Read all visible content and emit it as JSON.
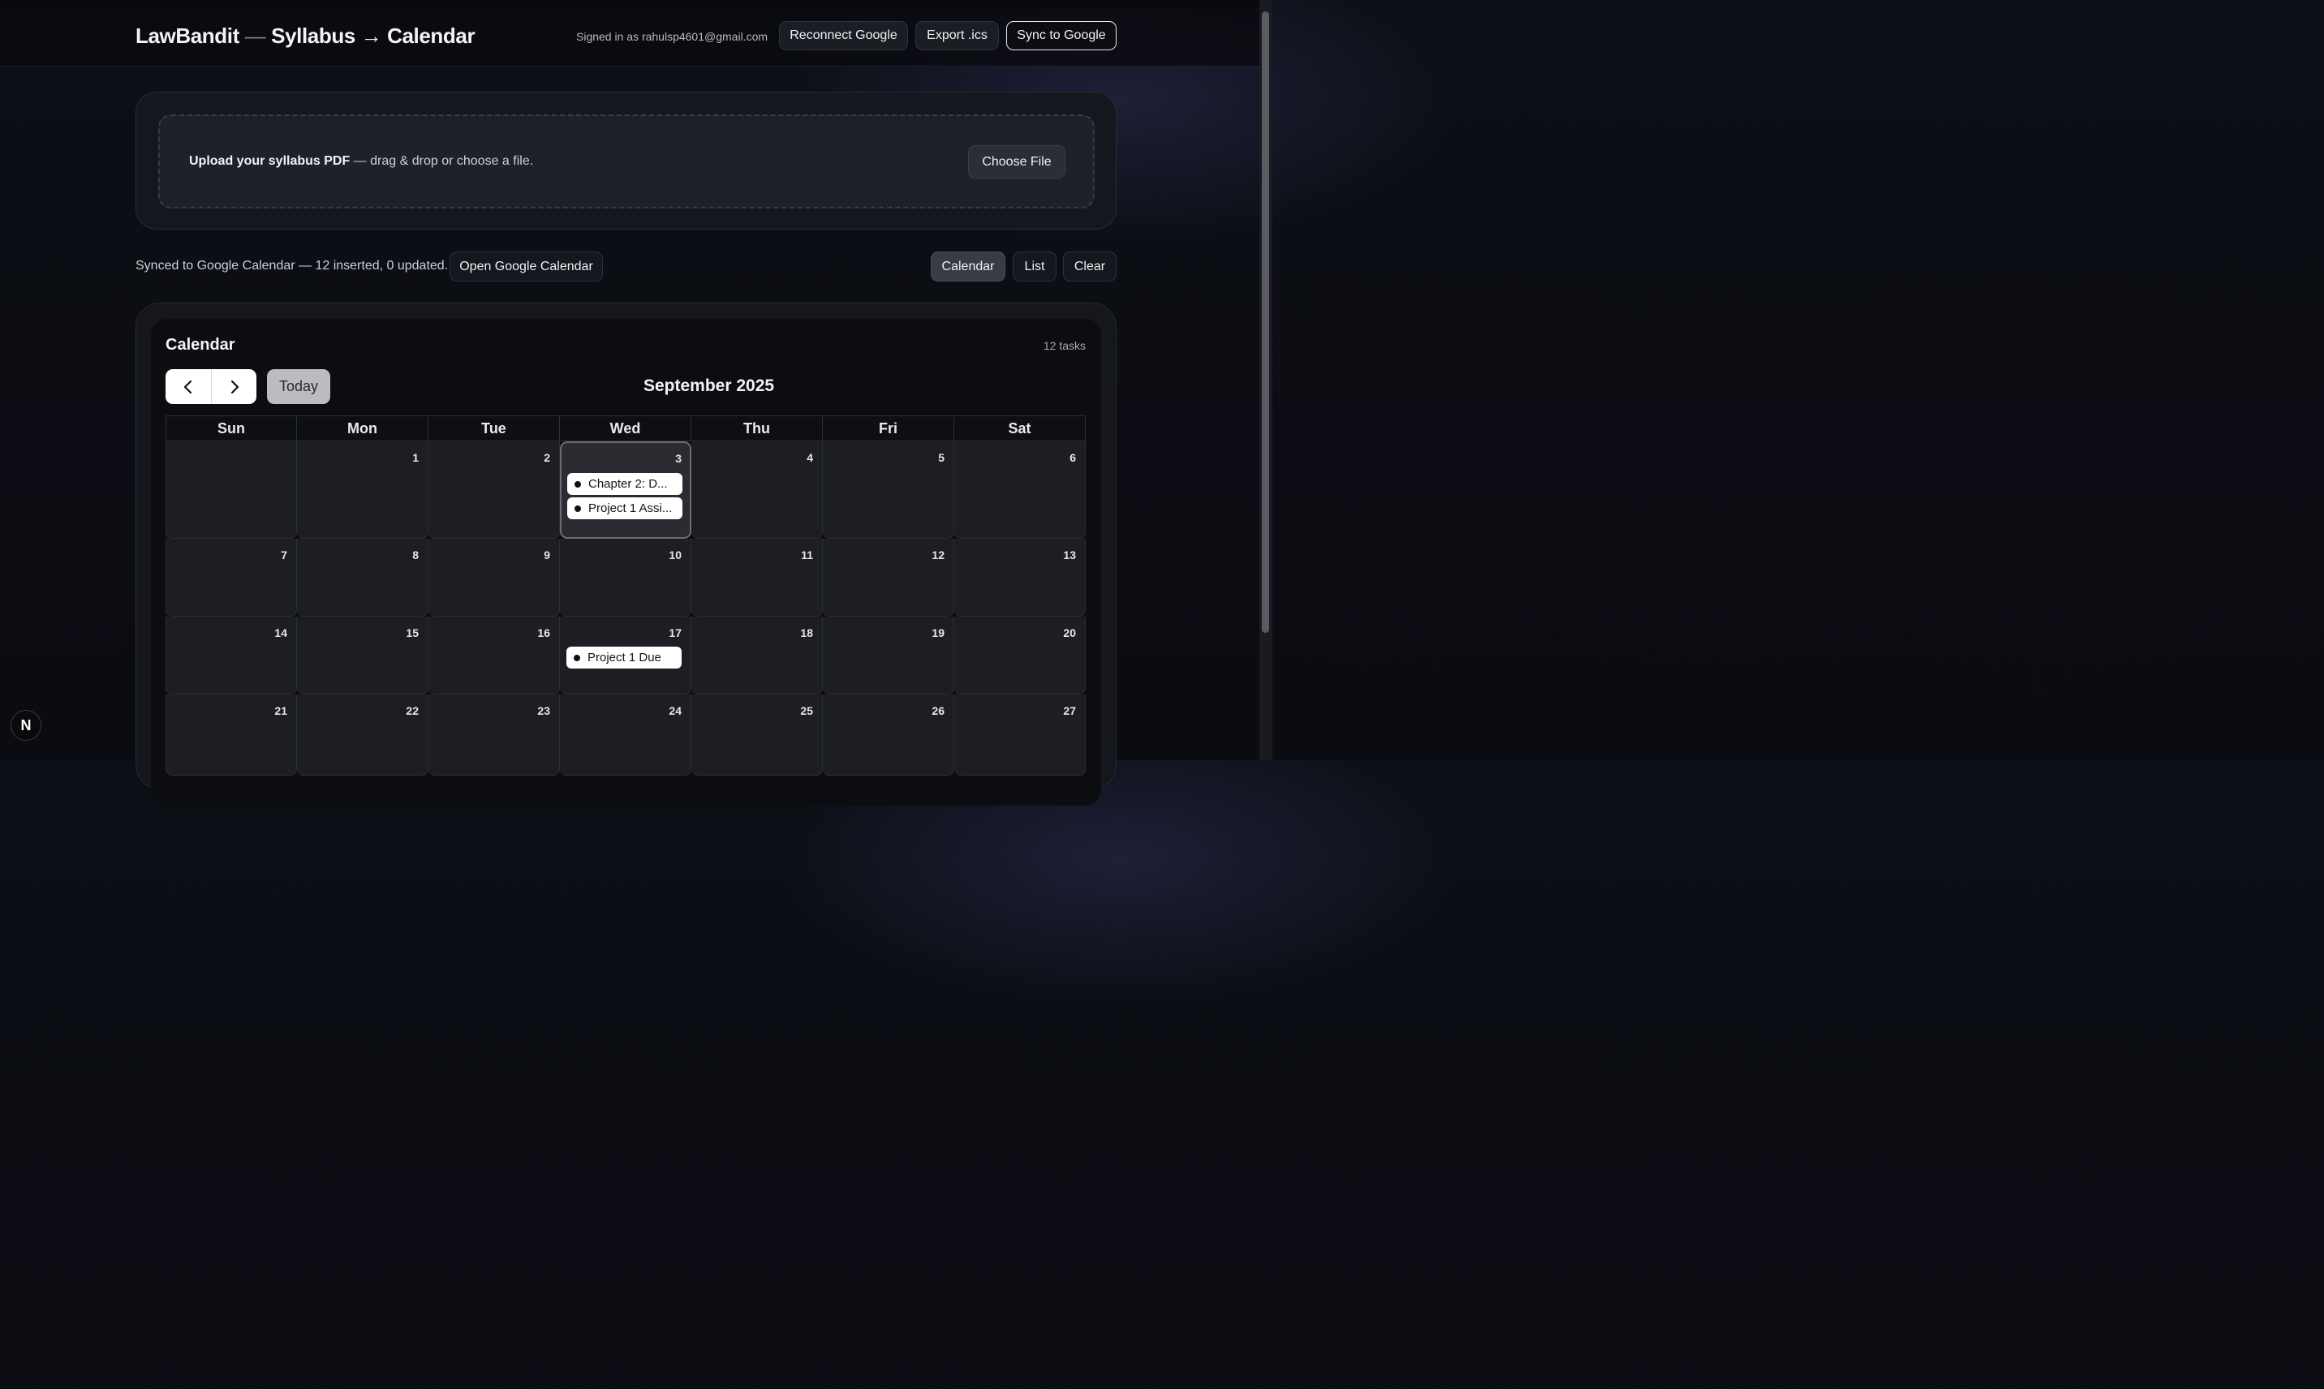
{
  "header": {
    "brand": "LawBandit",
    "brand_separator": "—",
    "subtitle": "Syllabus → Calendar",
    "signed_in_text": "Signed in as rahulsp4601@gmail.com",
    "buttons": {
      "reconnect": "Reconnect Google",
      "export": "Export .ics",
      "sync": "Sync to Google"
    }
  },
  "upload": {
    "bold_text": "Upload your syllabus PDF",
    "rest_text": " — drag & drop or choose a file.",
    "choose_button": "Choose File"
  },
  "status": {
    "message": "Synced to Google Calendar — 12 inserted, 0 updated.",
    "open_button": "Open Google Calendar"
  },
  "view_toggle": {
    "calendar": "Calendar",
    "list": "List",
    "clear": "Clear",
    "active": "Calendar"
  },
  "calendar": {
    "title": "Calendar",
    "task_count": "12 tasks",
    "today_button": "Today",
    "month_label": "September 2025",
    "weekdays": [
      "Sun",
      "Mon",
      "Tue",
      "Wed",
      "Thu",
      "Fri",
      "Sat"
    ],
    "weeks": [
      [
        {
          "num": "",
          "events": []
        },
        {
          "num": "1",
          "events": []
        },
        {
          "num": "2",
          "events": []
        },
        {
          "num": "3",
          "today": true,
          "events": [
            "Chapter 2: D...",
            "Project 1 Assi..."
          ]
        },
        {
          "num": "4",
          "events": []
        },
        {
          "num": "5",
          "events": []
        },
        {
          "num": "6",
          "events": []
        }
      ],
      [
        {
          "num": "7",
          "events": []
        },
        {
          "num": "8",
          "events": []
        },
        {
          "num": "9",
          "events": []
        },
        {
          "num": "10",
          "events": []
        },
        {
          "num": "11",
          "events": []
        },
        {
          "num": "12",
          "events": []
        },
        {
          "num": "13",
          "events": []
        }
      ],
      [
        {
          "num": "14",
          "events": []
        },
        {
          "num": "15",
          "events": []
        },
        {
          "num": "16",
          "events": []
        },
        {
          "num": "17",
          "events": [
            "Project 1 Due"
          ]
        },
        {
          "num": "18",
          "events": []
        },
        {
          "num": "19",
          "events": []
        },
        {
          "num": "20",
          "events": []
        }
      ],
      [
        {
          "num": "21",
          "events": []
        },
        {
          "num": "22",
          "events": []
        },
        {
          "num": "23",
          "events": []
        },
        {
          "num": "24",
          "events": []
        },
        {
          "num": "25",
          "events": []
        },
        {
          "num": "26",
          "events": []
        },
        {
          "num": "27",
          "events": []
        }
      ]
    ]
  },
  "dev_badge": "N"
}
